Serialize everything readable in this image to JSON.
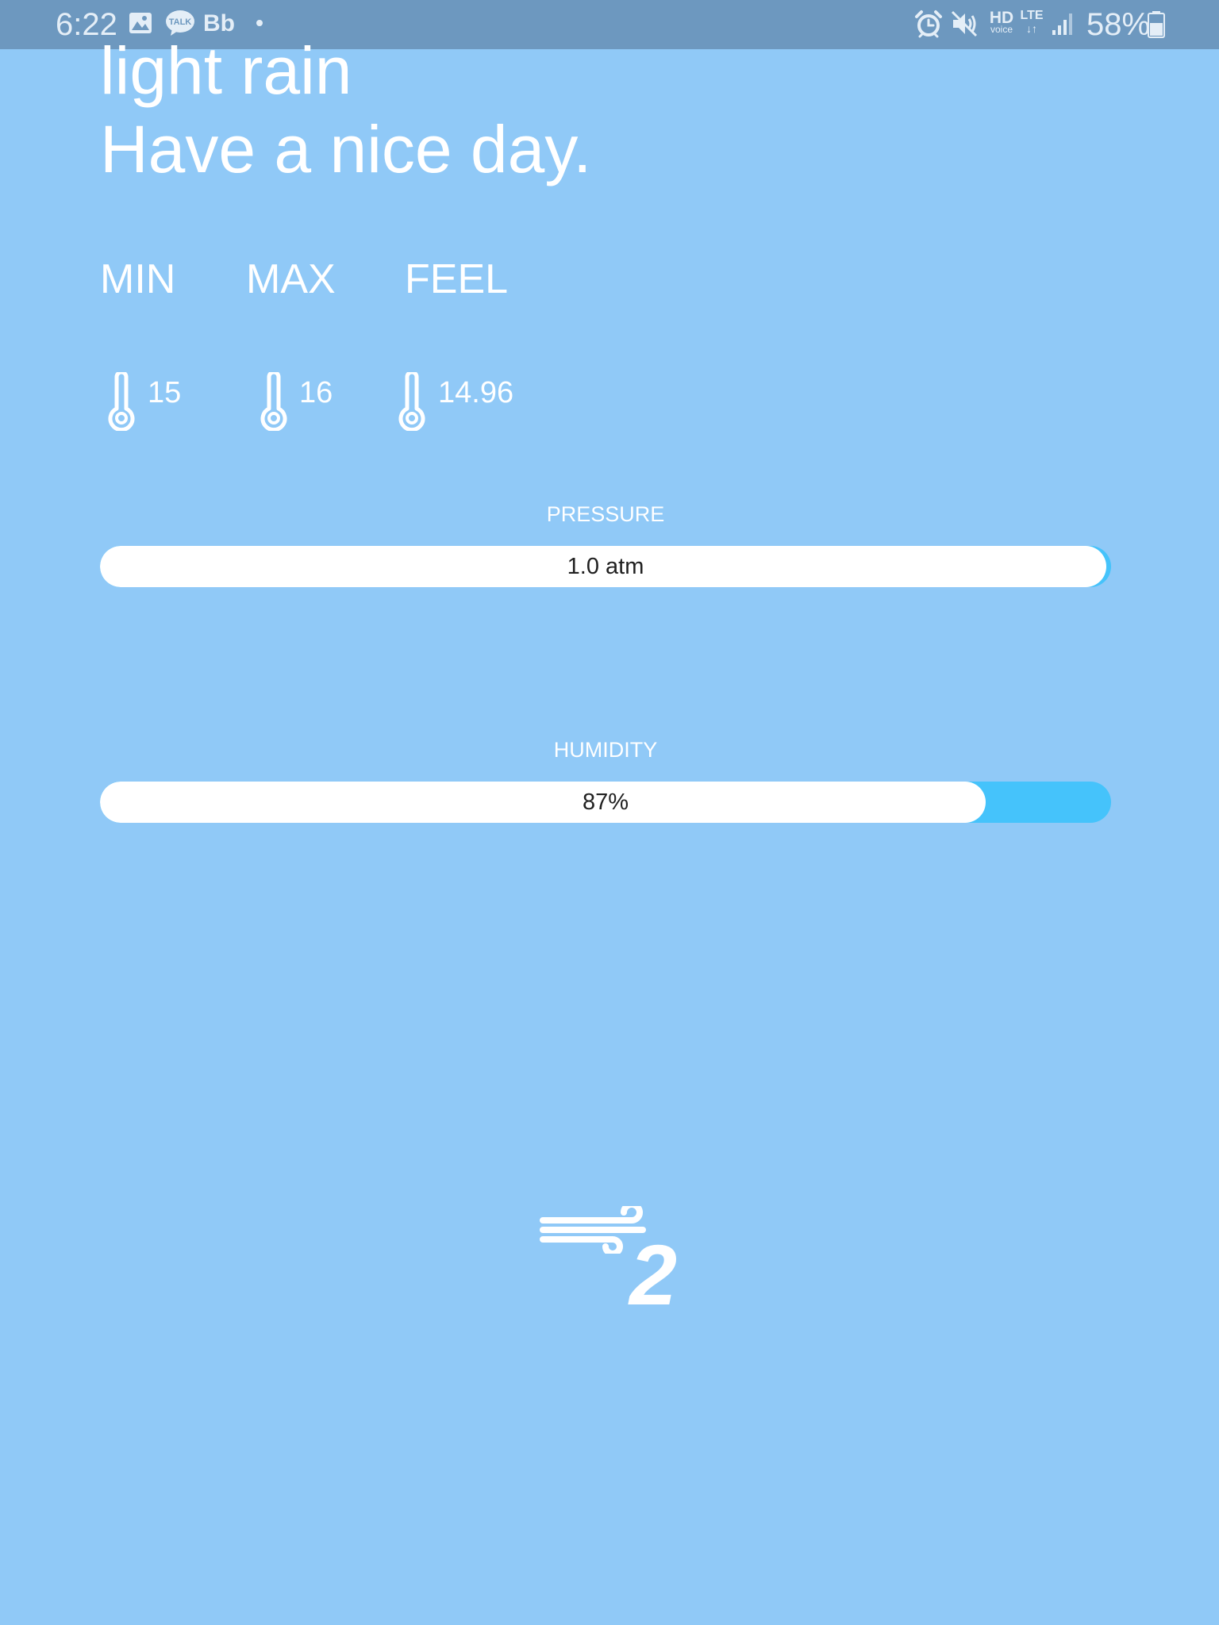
{
  "status_bar": {
    "time": "6:22",
    "notification_icons": [
      "image-icon",
      "kakaotalk-icon",
      "bb-icon",
      "dot-icon"
    ],
    "talk_label": "TALK",
    "bb_label": "Bb",
    "system_icons": [
      "alarm-icon",
      "mute-icon",
      "hd-voice-icon",
      "lte-icon",
      "signal-icon",
      "battery-icon"
    ],
    "hd_label": "HD",
    "voice_label": "voice",
    "lte_label": "LTE",
    "battery": "58%"
  },
  "weather": {
    "condition": "light rain",
    "greeting": "Have a nice day."
  },
  "temps": [
    {
      "label": "MIN",
      "value": "15"
    },
    {
      "label": "MAX",
      "value": "16"
    },
    {
      "label": "FEEL",
      "value": "14.96"
    }
  ],
  "pressure": {
    "title": "PRESSURE",
    "value": "1.0 atm",
    "fill_fraction": 0.995
  },
  "humidity": {
    "title": "HUMIDITY",
    "value": "87%",
    "fill_fraction": 0.876
  },
  "wind": {
    "value": "2"
  },
  "colors": {
    "background": "#90c9f7",
    "status_bar": "#6d98bf",
    "bar_track": "#45c3fb",
    "bar_fill": "#ffffff"
  }
}
